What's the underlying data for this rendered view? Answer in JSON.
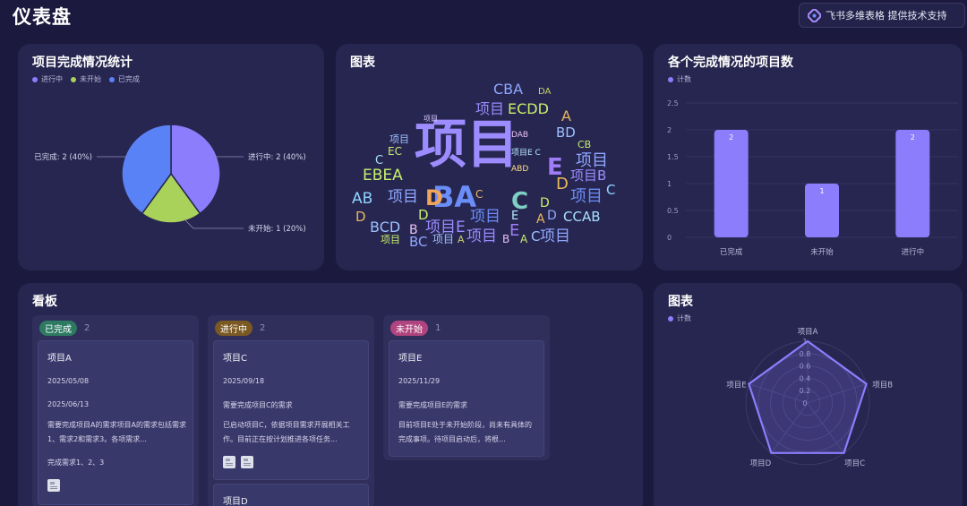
{
  "page": {
    "title": "仪表盘",
    "support_text": "飞书多维表格 提供技术支持"
  },
  "pie_card": {
    "title": "项目完成情况统计",
    "legend": [
      "进行中",
      "未开始",
      "已完成"
    ],
    "labels": {
      "in_progress": "进行中: 2 (40%)",
      "not_started": "未开始: 1 (20%)",
      "done": "已完成: 2 (40%)"
    }
  },
  "wordcloud_card": {
    "title": "图表"
  },
  "bar_card": {
    "title": "各个完成情况的项目数",
    "legend": "计数"
  },
  "kanban": {
    "title": "看板",
    "columns": [
      {
        "tag": "已完成",
        "count": "2",
        "cards": [
          {
            "title": "项目A",
            "date1": "2025/05/08",
            "date2": "2025/06/13",
            "text": "需要完成项目A的需求项目A的需求包括需求1、需求2和需求3。各项需求...",
            "note": "完成需求1、2、3"
          }
        ]
      },
      {
        "tag": "进行中",
        "count": "2",
        "cards": [
          {
            "title": "项目C",
            "date1": "2025/09/18",
            "text1": "需要完成项目C的需求",
            "text2": "已启动项目C，依据项目需求开展相关工作。目前正在按计划推进各项任务..."
          },
          {
            "title": "项目D"
          }
        ]
      },
      {
        "tag": "未开始",
        "count": "1",
        "cards": [
          {
            "title": "项目E",
            "date1": "2025/11/29",
            "text1": "需要完成项目E的需求",
            "text2": "目前项目E处于未开始阶段，尚未有具体的完成事项。待项目启动后，将根..."
          }
        ]
      }
    ]
  },
  "radar_card": {
    "title": "图表",
    "legend": "计数"
  },
  "colors": {
    "in_progress": "#8b7dfb",
    "not_started": "#a9d25b",
    "done": "#5a82f7",
    "bar": "#8b7dfb"
  },
  "chart_data": [
    {
      "type": "pie",
      "categories": [
        "进行中",
        "未开始",
        "已完成"
      ],
      "values": [
        2,
        1,
        2
      ],
      "title": "项目完成情况统计"
    },
    {
      "type": "bar",
      "title": "各个完成情况的项目数",
      "categories": [
        "已完成",
        "未开始",
        "进行中"
      ],
      "series": [
        {
          "name": "计数",
          "values": [
            2,
            1,
            2
          ]
        }
      ],
      "ylim": [
        0,
        2.5
      ],
      "yticks": [
        "2.5",
        "2",
        "1.5",
        "1",
        "0.5",
        "0"
      ],
      "grid": true,
      "legend": "top-left"
    },
    {
      "type": "radar",
      "title": "图表",
      "categories": [
        "项目A",
        "项目B",
        "项目C",
        "项目D",
        "项目E"
      ],
      "series": [
        {
          "name": "计数",
          "values": [
            1,
            1,
            1,
            1,
            1
          ]
        }
      ],
      "rlim": [
        0,
        1
      ],
      "rticks": [
        "0",
        "0.2",
        "0.4",
        "0.6",
        "0.8",
        "1"
      ],
      "legend": "top-left"
    }
  ]
}
